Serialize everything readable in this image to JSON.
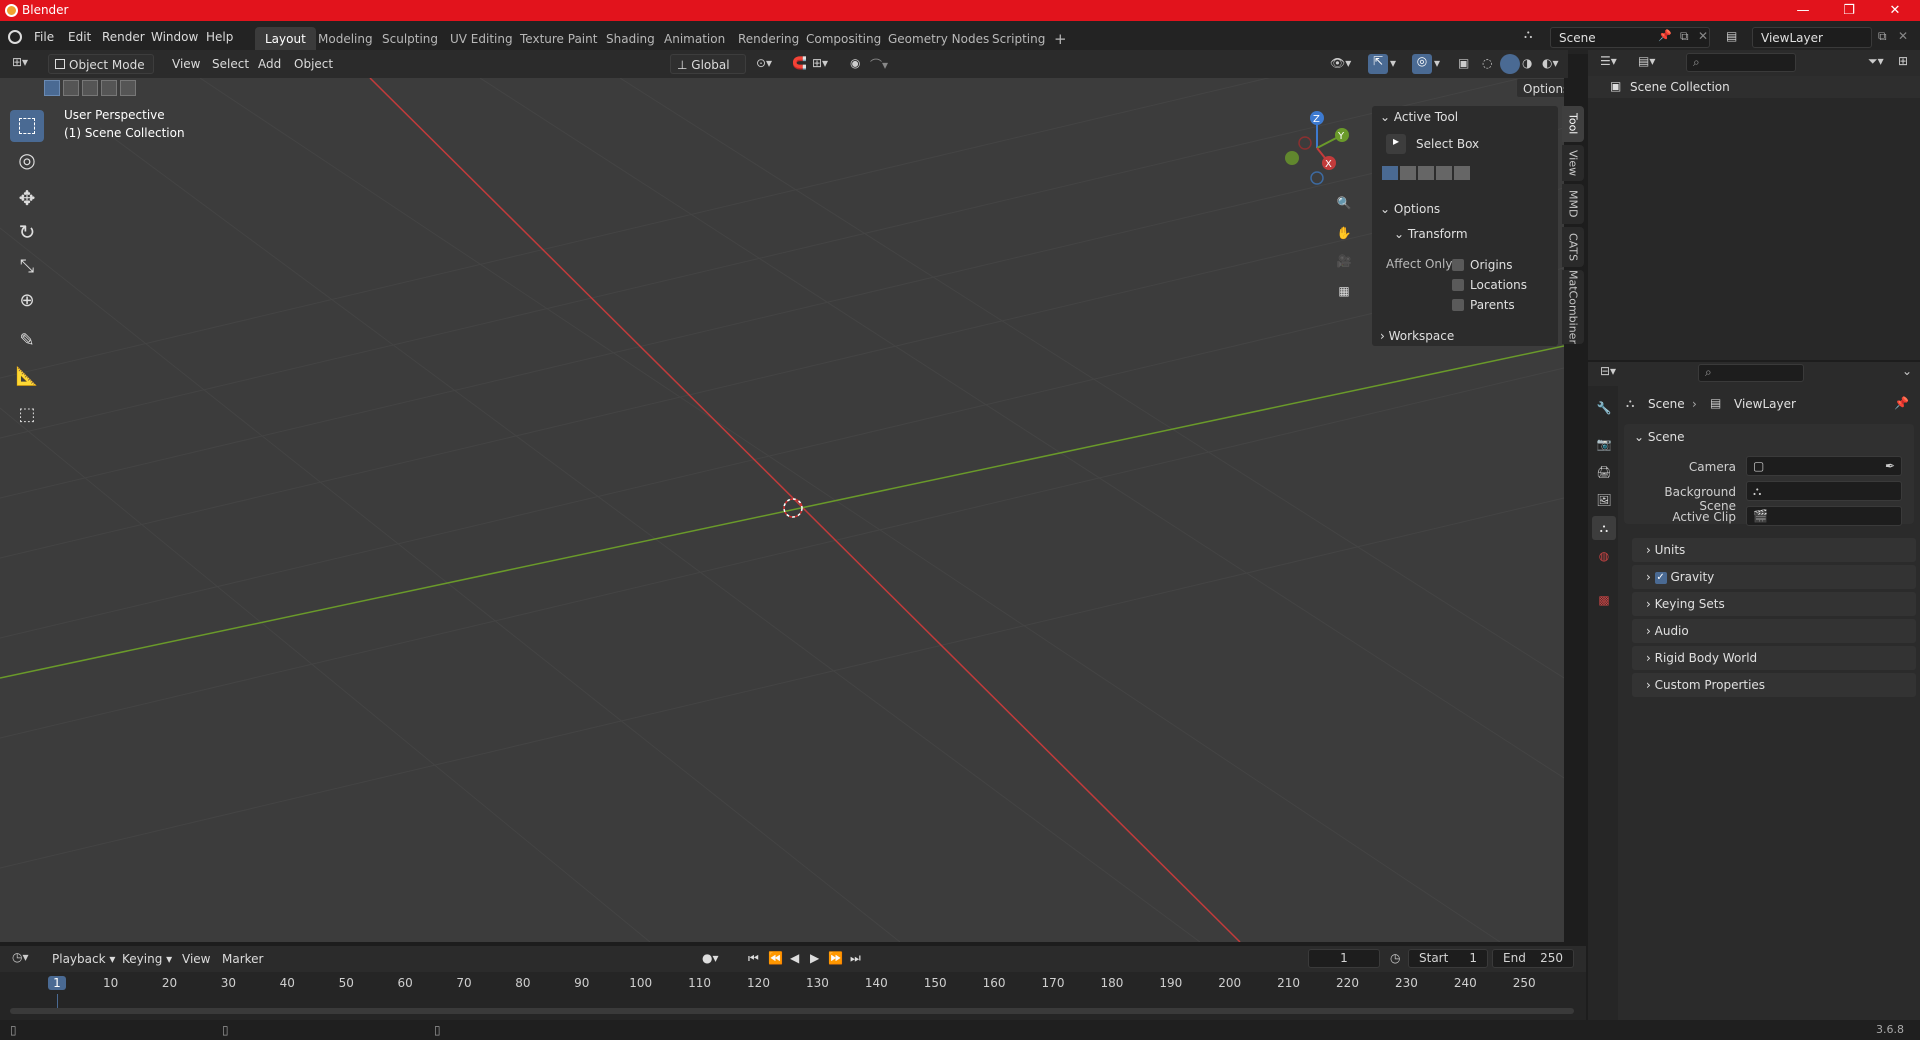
{
  "app": {
    "title": "Blender",
    "version": "3.6.8"
  },
  "menubar": [
    "File",
    "Edit",
    "Render",
    "Window",
    "Help"
  ],
  "workspaces": [
    {
      "label": "Layout",
      "active": true
    },
    {
      "label": "Modeling"
    },
    {
      "label": "Sculpting"
    },
    {
      "label": "UV Editing"
    },
    {
      "label": "Texture Paint"
    },
    {
      "label": "Shading"
    },
    {
      "label": "Animation"
    },
    {
      "label": "Rendering"
    },
    {
      "label": "Compositing"
    },
    {
      "label": "Geometry Nodes"
    },
    {
      "label": "Scripting"
    }
  ],
  "add_workspace": "+",
  "scene_selector": "Scene",
  "viewlayer_selector": "ViewLayer",
  "viewport_header": {
    "mode": "Object Mode",
    "menus": [
      "View",
      "Select",
      "Add",
      "Object"
    ],
    "orientation": "Global",
    "options": "Options"
  },
  "viewport": {
    "perspective": "User Perspective",
    "collection": "(1) Scene Collection",
    "gizmo": {
      "z": "Z",
      "y": "Y",
      "x": "X"
    }
  },
  "npanel": {
    "active_tool_header": "Active Tool",
    "tool_name": "Select Box",
    "options_header": "Options",
    "transform_header": "Transform",
    "affect_only": "Affect Only",
    "checks": [
      "Origins",
      "Locations",
      "Parents"
    ],
    "workspace_header": "Workspace",
    "tabs": [
      "Tool",
      "View",
      "MMD",
      "CATS",
      "MatCombiner"
    ]
  },
  "outliner": {
    "root": "Scene Collection"
  },
  "properties": {
    "breadcrumb": [
      "Scene",
      "ViewLayer"
    ],
    "scene_section": "Scene",
    "fields": [
      {
        "label": "Camera"
      },
      {
        "label": "Background Scene"
      },
      {
        "label": "Active Clip"
      }
    ],
    "sections": [
      "Units",
      "Gravity",
      "Keying Sets",
      "Audio",
      "Rigid Body World",
      "Custom Properties"
    ]
  },
  "timeline": {
    "menus": [
      "Playback",
      "Keying",
      "View",
      "Marker"
    ],
    "current_frame": "1",
    "start_label": "Start",
    "start": "1",
    "end_label": "End",
    "end": "250",
    "ticks": [
      "1",
      "10",
      "20",
      "30",
      "40",
      "50",
      "60",
      "70",
      "80",
      "90",
      "100",
      "110",
      "120",
      "130",
      "140",
      "150",
      "160",
      "170",
      "180",
      "190",
      "200",
      "210",
      "220",
      "230",
      "240",
      "250"
    ]
  },
  "colors": {
    "titlebar": "#e2131c",
    "accent": "#4a6a93",
    "x_axis": "#c23b3b",
    "y_axis": "#6a9a2a"
  }
}
